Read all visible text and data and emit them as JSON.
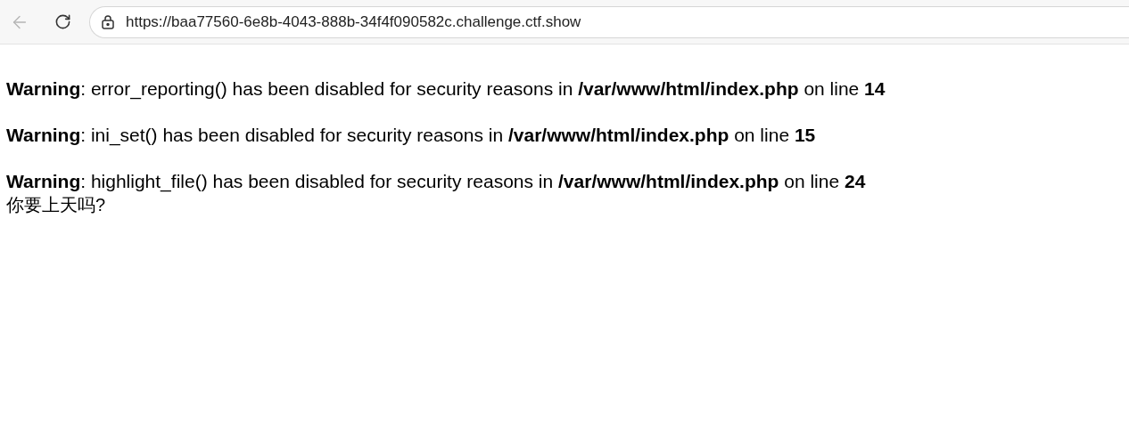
{
  "browser": {
    "url": "https://baa77560-6e8b-4043-888b-34f4f090582c.challenge.ctf.show",
    "back_disabled": true
  },
  "page": {
    "warnings": [
      "**Warning**: error_reporting() has been disabled for security reasons in **/var/www/html/index.php** on line **14**",
      "**Warning**: ini_set() has been disabled for security reasons in **/var/www/html/index.php** on line **15**",
      "**Warning**: highlight_file() has been disabled for security reasons in **/var/www/html/index.php** on line **24**"
    ],
    "output": "你要上天吗?"
  }
}
